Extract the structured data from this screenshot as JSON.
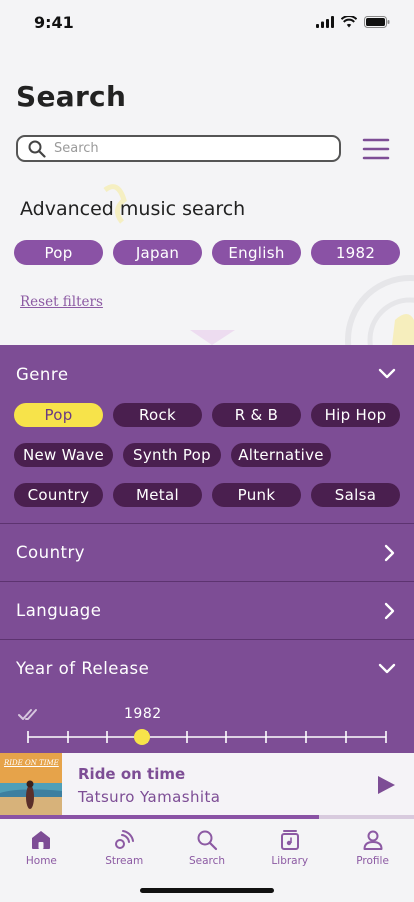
{
  "status": {
    "time": "9:41"
  },
  "header": {
    "title": "Search"
  },
  "search": {
    "placeholder": "Search",
    "value": ""
  },
  "advanced": {
    "title": "Advanced music search",
    "active_filters": [
      "Pop",
      "Japan",
      "English",
      "1982"
    ],
    "reset_label": "Reset filters"
  },
  "filters": {
    "genre": {
      "label": "Genre",
      "options": [
        "Pop",
        "Rock",
        "R & B",
        "Hip Hop",
        "New Wave",
        "Synth Pop",
        "Alternative",
        "Country",
        "Metal",
        "Punk",
        "Salsa"
      ],
      "selected": "Pop"
    },
    "country": {
      "label": "Country"
    },
    "language": {
      "label": "Language"
    },
    "year": {
      "label": "Year of Release",
      "value": "1982"
    }
  },
  "player": {
    "album_art_text": "RIDE ON TIME",
    "title": "Ride on time",
    "artist": "Tatsuro Yamashita",
    "progress": 0.77
  },
  "tabs": [
    {
      "label": "Home",
      "icon": "home-icon",
      "active": true
    },
    {
      "label": "Stream",
      "icon": "stream-icon",
      "active": false
    },
    {
      "label": "Search",
      "icon": "search-icon",
      "active": false
    },
    {
      "label": "Library",
      "icon": "library-icon",
      "active": false
    },
    {
      "label": "Profile",
      "icon": "profile-icon",
      "active": false
    }
  ],
  "colors": {
    "accent": "#7d4d95",
    "highlight": "#f7e34a",
    "chip_dark": "#4a1f4f"
  }
}
